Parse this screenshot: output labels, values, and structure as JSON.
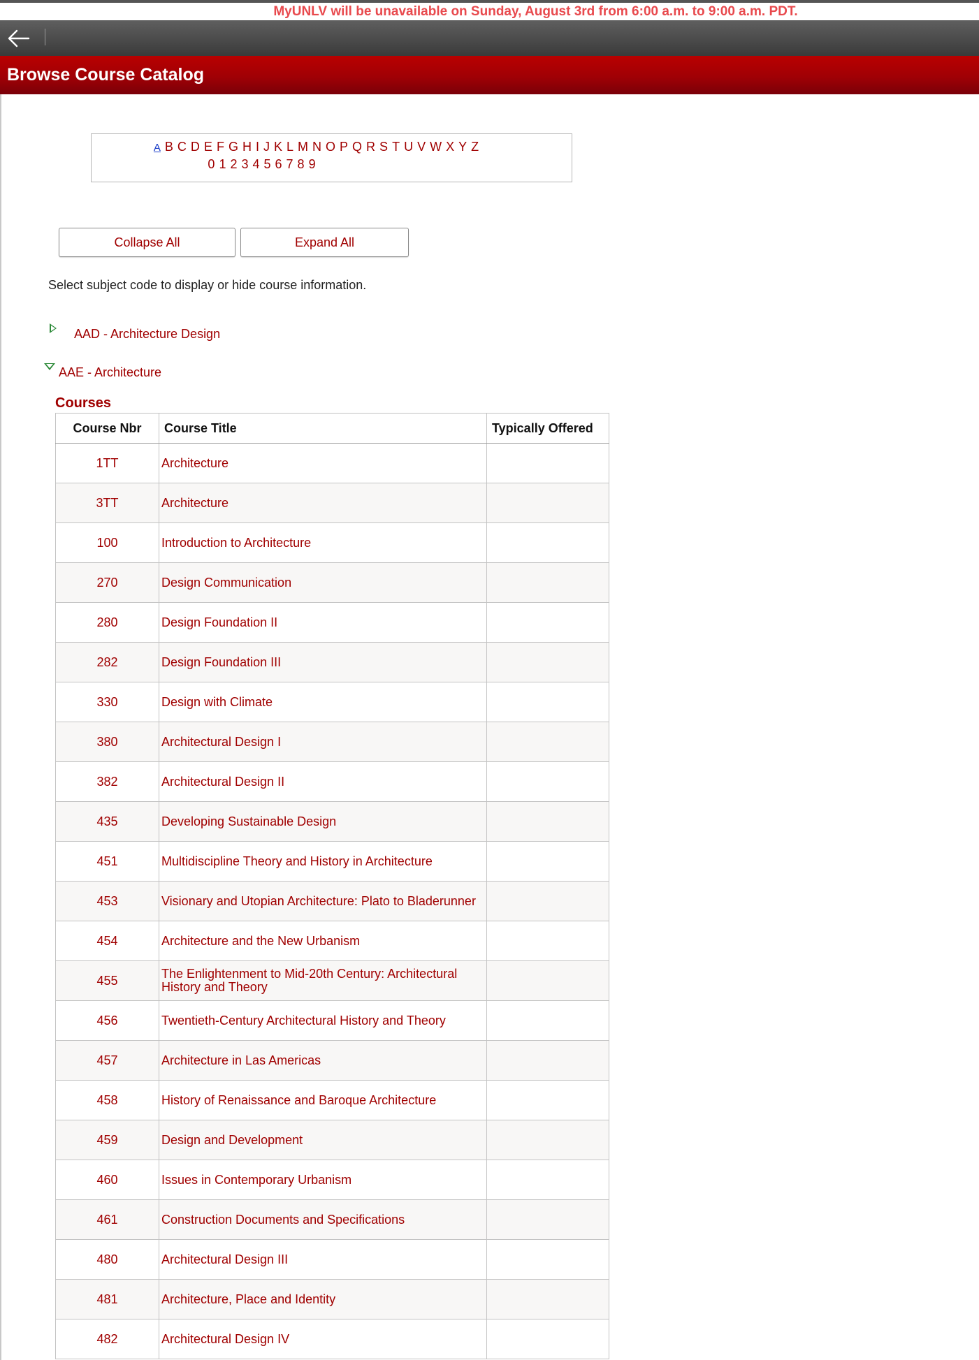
{
  "banner": {
    "notice": "MyUNLV will be unavailable on Sunday, August 3rd from 6:00 a.m. to 9:00 a.m. PDT."
  },
  "navbar": {
    "back_icon": "arrow-left-icon"
  },
  "header": {
    "title": "Browse Course Catalog"
  },
  "alphabet": {
    "letters": [
      "A",
      "B",
      "C",
      "D",
      "E",
      "F",
      "G",
      "H",
      "I",
      "J",
      "K",
      "L",
      "M",
      "N",
      "O",
      "P",
      "Q",
      "R",
      "S",
      "T",
      "U",
      "V",
      "W",
      "X",
      "Y",
      "Z"
    ],
    "digits": [
      "0",
      "1",
      "2",
      "3",
      "4",
      "5",
      "6",
      "7",
      "8",
      "9"
    ],
    "selected": "A"
  },
  "buttons": {
    "collapse_all": "Collapse All",
    "expand_all": "Expand All"
  },
  "instructions": "Select subject code to display or hide course information.",
  "subjects": [
    {
      "label": "AAD - Architecture Design",
      "expanded": false
    },
    {
      "label": "AAE - Architecture",
      "expanded": true
    }
  ],
  "courses": {
    "heading": "Courses",
    "columns": [
      "Course Nbr",
      "Course Title",
      "Typically Offered"
    ],
    "rows": [
      {
        "nbr": "1TT",
        "title": "Architecture",
        "offered": ""
      },
      {
        "nbr": "3TT",
        "title": "Architecture",
        "offered": ""
      },
      {
        "nbr": "100",
        "title": "Introduction to Architecture",
        "offered": ""
      },
      {
        "nbr": "270",
        "title": "Design Communication",
        "offered": ""
      },
      {
        "nbr": "280",
        "title": "Design Foundation II",
        "offered": ""
      },
      {
        "nbr": "282",
        "title": "Design Foundation III",
        "offered": ""
      },
      {
        "nbr": "330",
        "title": "Design with Climate",
        "offered": ""
      },
      {
        "nbr": "380",
        "title": "Architectural Design I",
        "offered": ""
      },
      {
        "nbr": "382",
        "title": "Architectural Design II",
        "offered": ""
      },
      {
        "nbr": "435",
        "title": "Developing Sustainable Design",
        "offered": ""
      },
      {
        "nbr": "451",
        "title": "Multidiscipline Theory and History in Architecture",
        "offered": ""
      },
      {
        "nbr": "453",
        "title": "Visionary and Utopian Architecture: Plato to Bladerunner",
        "offered": ""
      },
      {
        "nbr": "454",
        "title": "Architecture and the New Urbanism",
        "offered": ""
      },
      {
        "nbr": "455",
        "title": "The Enlightenment to Mid-20th Century: Architectural History and Theory",
        "offered": ""
      },
      {
        "nbr": "456",
        "title": "Twentieth-Century Architectural History and Theory",
        "offered": ""
      },
      {
        "nbr": "457",
        "title": "Architecture in Las Americas",
        "offered": ""
      },
      {
        "nbr": "458",
        "title": "History of Renaissance and Baroque Architecture",
        "offered": ""
      },
      {
        "nbr": "459",
        "title": "Design and Development",
        "offered": ""
      },
      {
        "nbr": "460",
        "title": "Issues in Contemporary Urbanism",
        "offered": ""
      },
      {
        "nbr": "461",
        "title": "Construction Documents and Specifications",
        "offered": ""
      },
      {
        "nbr": "480",
        "title": "Architectural Design III",
        "offered": ""
      },
      {
        "nbr": "481",
        "title": "Architecture, Place and Identity",
        "offered": ""
      },
      {
        "nbr": "482",
        "title": "Architectural Design IV",
        "offered": ""
      }
    ]
  }
}
